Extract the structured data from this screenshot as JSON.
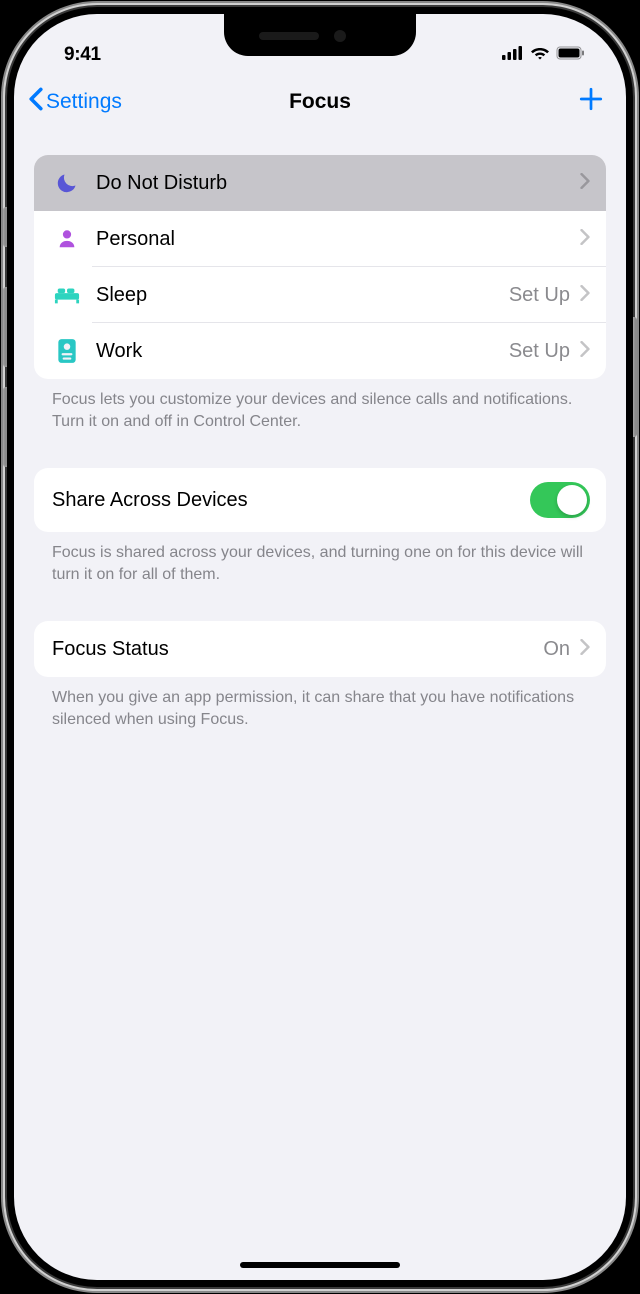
{
  "statusBar": {
    "time": "9:41"
  },
  "nav": {
    "back": "Settings",
    "title": "Focus"
  },
  "focusModes": [
    {
      "label": "Do Not Disturb",
      "detail": "",
      "icon": "moon",
      "color": "#5856d6",
      "highlighted": true
    },
    {
      "label": "Personal",
      "detail": "",
      "icon": "person",
      "color": "#af52de",
      "highlighted": false
    },
    {
      "label": "Sleep",
      "detail": "Set Up",
      "icon": "bed",
      "color": "#2dd4bf",
      "highlighted": false
    },
    {
      "label": "Work",
      "detail": "Set Up",
      "icon": "badge",
      "color": "#29c7c4",
      "highlighted": false
    }
  ],
  "footers": {
    "modes": "Focus lets you customize your devices and silence calls and notifications. Turn it on and off in Control Center.",
    "share": "Focus is shared across your devices, and turning one on for this device will turn it on for all of them.",
    "status": "When you give an app permission, it can share that you have notifications silenced when using Focus."
  },
  "shareAcrossDevices": {
    "label": "Share Across Devices",
    "on": true
  },
  "focusStatus": {
    "label": "Focus Status",
    "value": "On"
  }
}
